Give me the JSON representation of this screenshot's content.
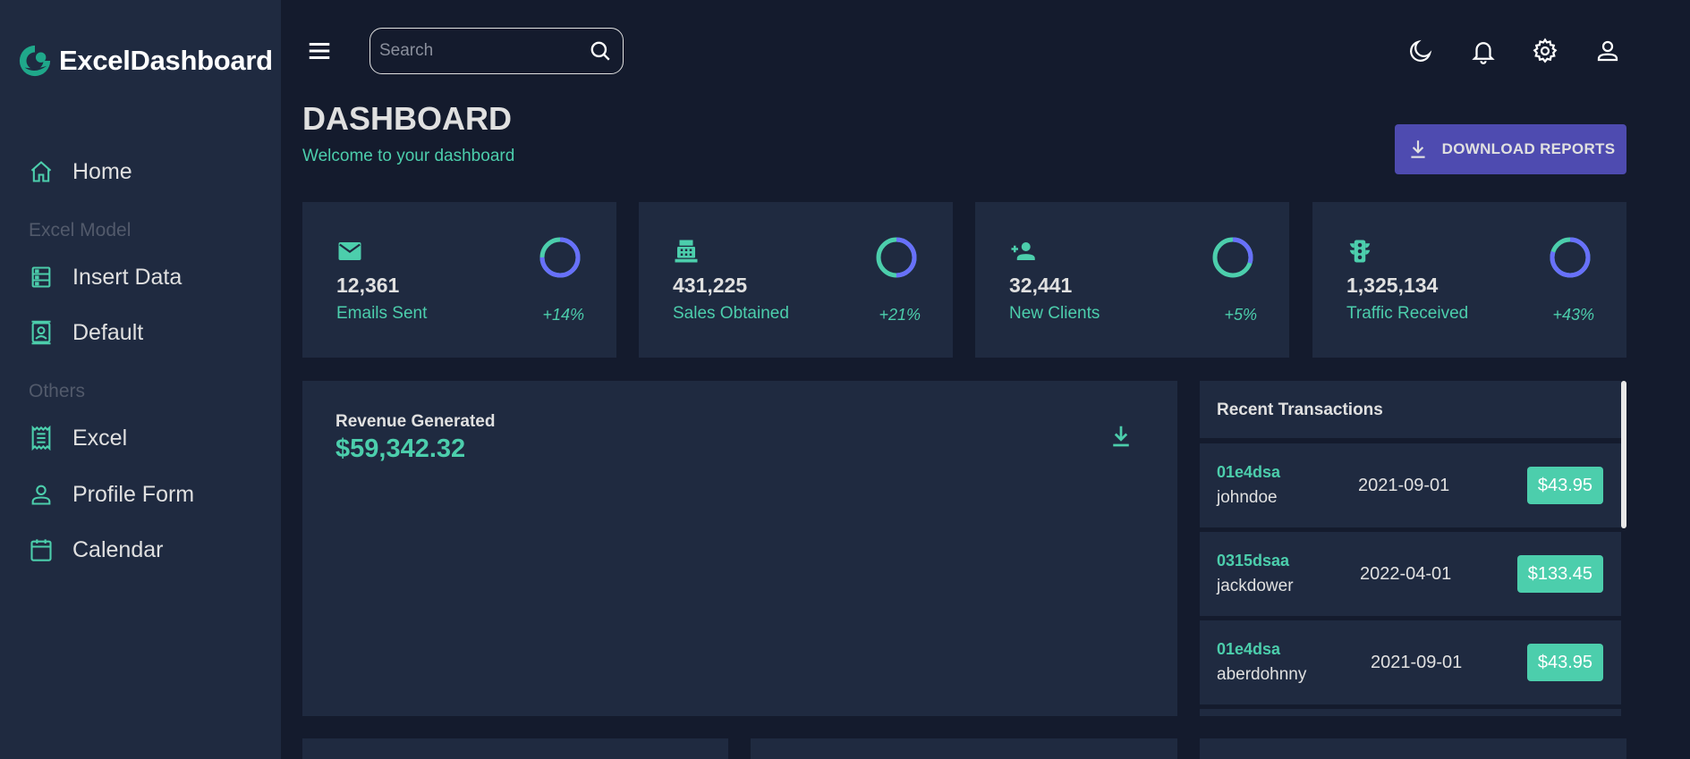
{
  "brand": {
    "name": "ExcelDashboard",
    "logo_icon": "logo-icon"
  },
  "sidebar": {
    "items": [
      {
        "label": "Home",
        "icon": "home-icon"
      },
      {
        "label": "Insert Data",
        "icon": "insert-data-icon"
      },
      {
        "label": "Default",
        "icon": "contact-card-icon"
      },
      {
        "label": "Excel",
        "icon": "receipt-icon"
      },
      {
        "label": "Profile Form",
        "icon": "person-icon"
      },
      {
        "label": "Calendar",
        "icon": "calendar-icon"
      }
    ],
    "sections": [
      "Excel Model",
      "Others"
    ]
  },
  "topbar": {
    "search_placeholder": "Search",
    "icons": [
      "menu-icon",
      "search-icon",
      "dark-mode-icon",
      "notifications-icon",
      "settings-icon",
      "person-icon"
    ]
  },
  "header": {
    "title": "DASHBOARD",
    "subtitle": "Welcome to your dashboard",
    "download_label": "DOWNLOAD REPORTS"
  },
  "stats": [
    {
      "value": "12,361",
      "label": "Emails Sent",
      "change": "+14%",
      "progress": 0.75,
      "icon": "email-icon"
    },
    {
      "value": "431,225",
      "label": "Sales Obtained",
      "change": "+21%",
      "progress": 0.5,
      "icon": "point-of-sale-icon"
    },
    {
      "value": "32,441",
      "label": "New Clients",
      "change": "+5%",
      "progress": 0.3,
      "icon": "person-add-icon"
    },
    {
      "value": "1,325,134",
      "label": "Traffic Received",
      "change": "+43%",
      "progress": 0.8,
      "icon": "traffic-icon"
    }
  ],
  "revenue": {
    "title": "Revenue Generated",
    "amount": "$59,342.32"
  },
  "transactions": {
    "title": "Recent Transactions",
    "rows": [
      {
        "txId": "01e4dsa",
        "user": "johndoe",
        "date": "2021-09-01",
        "cost": "$43.95"
      },
      {
        "txId": "0315dsaa",
        "user": "jackdower",
        "date": "2022-04-01",
        "cost": "$133.45"
      },
      {
        "txId": "01e4dsa",
        "user": "aberdohnny",
        "date": "2021-09-01",
        "cost": "$43.95"
      }
    ]
  },
  "colors": {
    "background": "#141b2d",
    "panel": "#1f2a40",
    "accent_green": "#4cceac",
    "accent_blue": "#6870fa",
    "button": "#4e4bb0",
    "text": "#e0e0e0"
  }
}
